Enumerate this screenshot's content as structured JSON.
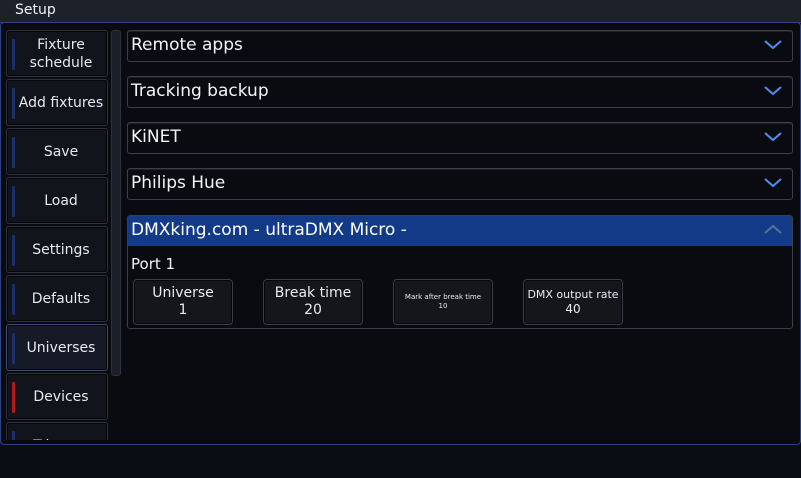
{
  "window": {
    "title": "Setup"
  },
  "sidebar": {
    "items": [
      {
        "label": "Fixture schedule",
        "active": false
      },
      {
        "label": "Add fixtures",
        "active": false
      },
      {
        "label": "Save",
        "active": false
      },
      {
        "label": "Load",
        "active": false
      },
      {
        "label": "Settings",
        "active": false
      },
      {
        "label": "Defaults",
        "active": false
      },
      {
        "label": "Universes",
        "active": true
      },
      {
        "label": "Devices",
        "active": false,
        "indicator": "red"
      },
      {
        "label": "Triggers",
        "active": false
      }
    ]
  },
  "sections": [
    {
      "title": "Remote apps",
      "state": "collapsed"
    },
    {
      "title": "Tracking backup",
      "state": "collapsed"
    },
    {
      "title": "KiNET",
      "state": "collapsed"
    },
    {
      "title": "Philips Hue",
      "state": "collapsed"
    }
  ],
  "device": {
    "title": "DMXking.com - ultraDMX Micro -",
    "state": "expanded",
    "port": "Port 1",
    "params": [
      {
        "label": "Universe",
        "value": "1"
      },
      {
        "label": "Break time",
        "value": "20"
      },
      {
        "label": "Mark after break time",
        "value": "10"
      },
      {
        "label": "DMX output rate",
        "value": "40"
      }
    ]
  },
  "colors": {
    "accent": "#123a86",
    "chevron": "#4f8df0",
    "devices_indicator": "#b01a1a",
    "nav_indicator": "#1a2f6b"
  },
  "icons": {
    "collapsed": "chevron-down-icon",
    "expanded": "chevron-up-icon"
  }
}
